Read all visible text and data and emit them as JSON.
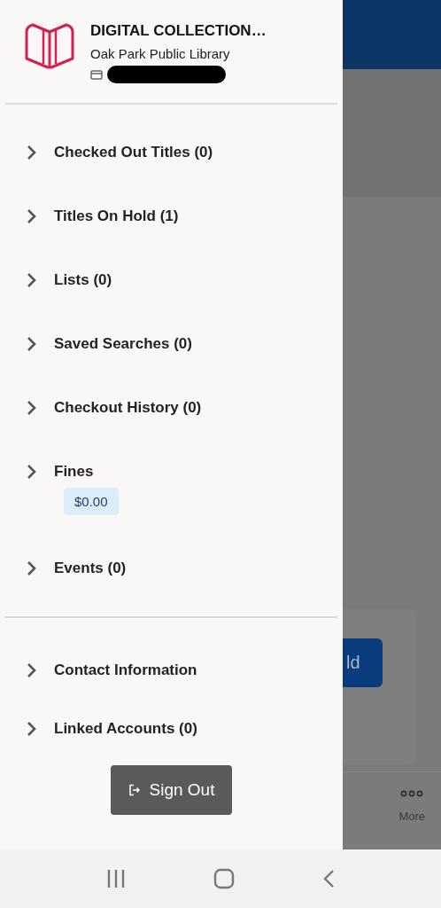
{
  "drawer": {
    "app_title": "DIGITAL COLLECTION…",
    "library": "Oak Park Public Library",
    "sections": [
      {
        "items": [
          {
            "label": "Checked Out Titles (0)"
          },
          {
            "label": "Titles On Hold (1)"
          },
          {
            "label": "Lists (0)"
          },
          {
            "label": "Saved Searches (0)"
          },
          {
            "label": "Checkout History (0)"
          },
          {
            "label": "Fines",
            "badge": "$0.00"
          },
          {
            "label": "Events (0)"
          }
        ]
      },
      {
        "items": [
          {
            "label": "Contact Information"
          },
          {
            "label": "Linked Accounts (0)"
          }
        ]
      }
    ],
    "sign_out_button": "Sign Out"
  },
  "background": {
    "button_label": "ld",
    "nav_item": "More"
  }
}
